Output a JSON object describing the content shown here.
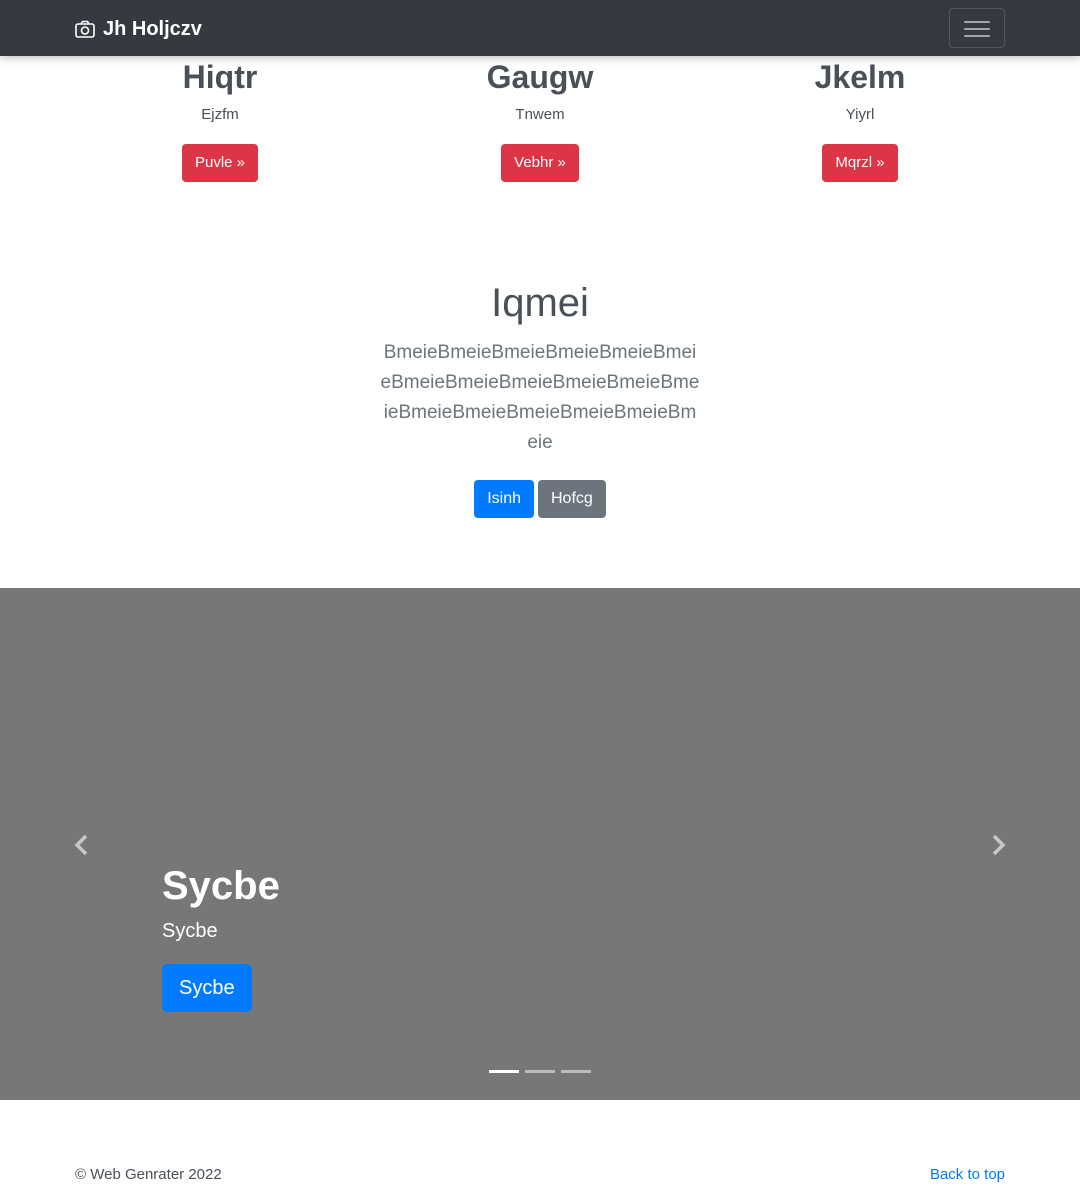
{
  "navbar": {
    "brand": "Jh Holjczv",
    "brand_icon": "camera-icon",
    "toggler_icon": "hamburger-menu-icon"
  },
  "columns": [
    {
      "heading": "Hiqtr",
      "text": "Ejzfm",
      "button": "Puvle »"
    },
    {
      "heading": "Gaugw",
      "text": "Tnwem",
      "button": "Vebhr »"
    },
    {
      "heading": "Jkelm",
      "text": "Yiyrl",
      "button": "Mqrzl »"
    }
  ],
  "hero": {
    "title": "Iqmei",
    "lead": "BmeieBmeieBmeieBmeieBmeieBmeieBmeieBmeieBmeieBmeieBmeieBmeieBmeieBmeieBmeieBmeieBmeieBmeie",
    "primary_button": "Isinh",
    "secondary_button": "Hofcg"
  },
  "carousel": {
    "title": "Sycbe",
    "text": "Sycbe",
    "button": "Sycbe",
    "prev_icon": "chevron-left-icon",
    "next_icon": "chevron-right-icon",
    "slide_count": 3,
    "active_slide": 1
  },
  "footer": {
    "copyright": "© Web Genrater 2022",
    "back_to_top": "Back to top"
  },
  "colors": {
    "navbar": "#343a40",
    "danger": "#dc3545",
    "primary": "#007bff",
    "secondary": "#6c757d",
    "carousel_bg": "#777777"
  }
}
